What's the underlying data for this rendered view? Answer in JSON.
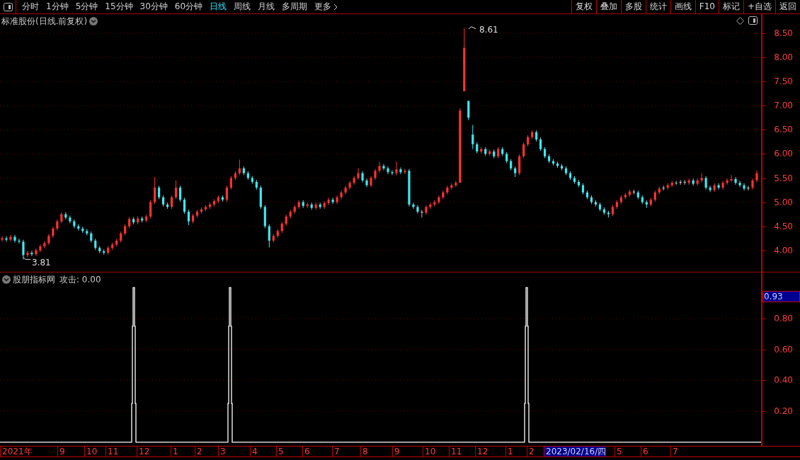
{
  "toolbar": {
    "periods": [
      {
        "label": "分时",
        "selected": false
      },
      {
        "label": "1分钟",
        "selected": false
      },
      {
        "label": "5分钟",
        "selected": false
      },
      {
        "label": "15分钟",
        "selected": false
      },
      {
        "label": "30分钟",
        "selected": false
      },
      {
        "label": "60分钟",
        "selected": false
      },
      {
        "label": "日线",
        "selected": true
      },
      {
        "label": "周线",
        "selected": false
      },
      {
        "label": "月线",
        "selected": false
      },
      {
        "label": "多周期",
        "selected": false
      }
    ],
    "more": "更多",
    "tools": [
      "复权",
      "叠加",
      "多股",
      "统计",
      "画线",
      "F10",
      "标记",
      "+自选",
      "返回"
    ]
  },
  "price_chart": {
    "title": "标准股份(日线.前复权)",
    "high_label": "8.61",
    "low_label": "3.81",
    "chart_data": {
      "type": "candlestick",
      "ohlc": [
        [
          4.22,
          4.29,
          4.18,
          4.25
        ],
        [
          4.25,
          4.29,
          4.18,
          4.22
        ],
        [
          4.22,
          4.32,
          4.18,
          4.28
        ],
        [
          4.28,
          4.32,
          4.16,
          4.2
        ],
        [
          4.2,
          4.24,
          4.14,
          4.18
        ],
        [
          4.18,
          4.22,
          3.81,
          3.9
        ],
        [
          3.9,
          3.99,
          3.86,
          3.95
        ],
        [
          3.95,
          3.99,
          3.88,
          3.92
        ],
        [
          3.92,
          4.04,
          3.88,
          4.0
        ],
        [
          4.0,
          4.12,
          3.96,
          4.08
        ],
        [
          4.08,
          4.19,
          4.04,
          4.15
        ],
        [
          4.15,
          4.34,
          4.11,
          4.3
        ],
        [
          4.3,
          4.49,
          4.26,
          4.45
        ],
        [
          4.45,
          4.64,
          4.41,
          4.6
        ],
        [
          4.6,
          4.79,
          4.56,
          4.75
        ],
        [
          4.75,
          4.79,
          4.64,
          4.68
        ],
        [
          4.68,
          4.72,
          4.56,
          4.6
        ],
        [
          4.6,
          4.64,
          4.46,
          4.5
        ],
        [
          4.5,
          4.54,
          4.41,
          4.45
        ],
        [
          4.45,
          4.49,
          4.36,
          4.4
        ],
        [
          4.4,
          4.44,
          4.31,
          4.35
        ],
        [
          4.35,
          4.39,
          4.16,
          4.2
        ],
        [
          4.2,
          4.24,
          4.01,
          4.05
        ],
        [
          4.05,
          4.09,
          3.94,
          3.98
        ],
        [
          3.98,
          4.02,
          3.91,
          3.95
        ],
        [
          3.95,
          4.09,
          3.91,
          4.05
        ],
        [
          4.05,
          4.16,
          4.01,
          4.12
        ],
        [
          4.12,
          4.24,
          4.08,
          4.2
        ],
        [
          4.2,
          4.39,
          4.16,
          4.35
        ],
        [
          4.35,
          4.54,
          4.31,
          4.5
        ],
        [
          4.5,
          4.69,
          4.46,
          4.65
        ],
        [
          4.65,
          4.69,
          4.54,
          4.58
        ],
        [
          4.58,
          4.7,
          4.54,
          4.66
        ],
        [
          4.66,
          4.7,
          4.58,
          4.62
        ],
        [
          4.62,
          4.74,
          4.58,
          4.7
        ],
        [
          4.7,
          5.04,
          4.66,
          5.0
        ],
        [
          5.0,
          5.52,
          4.96,
          5.3
        ],
        [
          5.3,
          5.34,
          5.06,
          5.1
        ],
        [
          5.1,
          5.14,
          4.91,
          4.95
        ],
        [
          4.95,
          4.99,
          4.86,
          4.9
        ],
        [
          4.9,
          5.14,
          4.86,
          5.1
        ],
        [
          5.1,
          5.45,
          5.06,
          5.3
        ],
        [
          5.3,
          5.34,
          5.01,
          5.05
        ],
        [
          5.05,
          5.09,
          4.76,
          4.8
        ],
        [
          4.8,
          4.84,
          4.52,
          4.6
        ],
        [
          4.6,
          4.76,
          4.56,
          4.72
        ],
        [
          4.72,
          4.84,
          4.68,
          4.8
        ],
        [
          4.8,
          4.89,
          4.76,
          4.85
        ],
        [
          4.85,
          4.94,
          4.81,
          4.9
        ],
        [
          4.9,
          4.99,
          4.86,
          4.95
        ],
        [
          4.95,
          5.06,
          4.91,
          5.02
        ],
        [
          5.02,
          5.14,
          4.98,
          5.1
        ],
        [
          5.1,
          5.14,
          5.01,
          5.05
        ],
        [
          5.05,
          5.34,
          5.01,
          5.3
        ],
        [
          5.3,
          5.54,
          5.26,
          5.5
        ],
        [
          5.5,
          5.64,
          5.46,
          5.6
        ],
        [
          5.6,
          5.88,
          5.56,
          5.7
        ],
        [
          5.7,
          5.74,
          5.56,
          5.6
        ],
        [
          5.6,
          5.64,
          5.46,
          5.5
        ],
        [
          5.5,
          5.54,
          5.38,
          5.42
        ],
        [
          5.42,
          5.46,
          5.26,
          5.3
        ],
        [
          5.3,
          5.34,
          4.86,
          4.9
        ],
        [
          4.9,
          4.94,
          4.46,
          4.5
        ],
        [
          4.5,
          4.54,
          4.06,
          4.2
        ],
        [
          4.2,
          4.34,
          4.16,
          4.3
        ],
        [
          4.3,
          4.44,
          4.26,
          4.4
        ],
        [
          4.4,
          4.59,
          4.36,
          4.55
        ],
        [
          4.55,
          4.74,
          4.51,
          4.7
        ],
        [
          4.7,
          4.84,
          4.66,
          4.8
        ],
        [
          4.8,
          4.94,
          4.76,
          4.9
        ],
        [
          4.9,
          5.04,
          4.86,
          5.0
        ],
        [
          5.0,
          5.04,
          4.88,
          4.92
        ],
        [
          4.92,
          4.99,
          4.88,
          4.95
        ],
        [
          4.95,
          4.99,
          4.84,
          4.88
        ],
        [
          4.88,
          4.99,
          4.84,
          4.95
        ],
        [
          4.95,
          4.99,
          4.86,
          4.9
        ],
        [
          4.9,
          5.02,
          4.86,
          4.98
        ],
        [
          4.98,
          5.09,
          4.94,
          5.05
        ],
        [
          5.05,
          5.09,
          4.96,
          5.0
        ],
        [
          5.0,
          5.14,
          4.96,
          5.1
        ],
        [
          5.1,
          5.24,
          5.06,
          5.2
        ],
        [
          5.2,
          5.34,
          5.16,
          5.3
        ],
        [
          5.3,
          5.44,
          5.26,
          5.4
        ],
        [
          5.4,
          5.54,
          5.36,
          5.5
        ],
        [
          5.5,
          5.7,
          5.46,
          5.6
        ],
        [
          5.6,
          5.64,
          5.41,
          5.45
        ],
        [
          5.45,
          5.49,
          5.31,
          5.35
        ],
        [
          5.35,
          5.54,
          5.31,
          5.5
        ],
        [
          5.5,
          5.69,
          5.46,
          5.65
        ],
        [
          5.65,
          5.84,
          5.61,
          5.75
        ],
        [
          5.75,
          5.79,
          5.66,
          5.7
        ],
        [
          5.7,
          5.74,
          5.58,
          5.62
        ],
        [
          5.62,
          5.66,
          5.56,
          5.6
        ],
        [
          5.6,
          5.84,
          5.56,
          5.68
        ],
        [
          5.68,
          5.72,
          5.58,
          5.62
        ],
        [
          5.62,
          5.69,
          5.58,
          5.65
        ],
        [
          5.65,
          5.69,
          4.91,
          4.95
        ],
        [
          4.95,
          4.99,
          4.86,
          4.9
        ],
        [
          4.9,
          4.94,
          4.76,
          4.8
        ],
        [
          4.8,
          4.84,
          4.68,
          4.78
        ],
        [
          4.78,
          4.94,
          4.74,
          4.9
        ],
        [
          4.9,
          4.99,
          4.86,
          4.95
        ],
        [
          4.95,
          5.04,
          4.91,
          5.0
        ],
        [
          5.0,
          5.14,
          4.96,
          5.1
        ],
        [
          5.1,
          5.24,
          5.06,
          5.2
        ],
        [
          5.2,
          5.34,
          5.16,
          5.3
        ],
        [
          5.3,
          5.39,
          5.26,
          5.35
        ],
        [
          5.35,
          5.44,
          5.31,
          5.4
        ],
        [
          5.4,
          6.95,
          5.4,
          6.9
        ],
        [
          7.3,
          8.61,
          7.3,
          8.2
        ],
        [
          7.1,
          7.1,
          6.7,
          6.75
        ],
        [
          6.4,
          6.6,
          6.1,
          6.2
        ],
        [
          6.2,
          6.24,
          6.01,
          6.05
        ],
        [
          6.05,
          6.14,
          6.01,
          6.1
        ],
        [
          6.1,
          6.14,
          5.96,
          6.0
        ],
        [
          6.0,
          6.09,
          5.96,
          6.05
        ],
        [
          6.05,
          6.09,
          5.91,
          5.95
        ],
        [
          5.95,
          6.14,
          5.91,
          6.1
        ],
        [
          6.1,
          6.14,
          5.96,
          6.0
        ],
        [
          6.0,
          6.04,
          5.81,
          5.85
        ],
        [
          5.85,
          5.89,
          5.66,
          5.7
        ],
        [
          5.7,
          5.74,
          5.52,
          5.6
        ],
        [
          5.6,
          5.99,
          5.56,
          5.95
        ],
        [
          5.95,
          6.24,
          5.91,
          6.2
        ],
        [
          6.2,
          6.39,
          6.16,
          6.35
        ],
        [
          6.35,
          6.49,
          6.31,
          6.45
        ],
        [
          6.45,
          6.49,
          6.26,
          6.3
        ],
        [
          6.3,
          6.34,
          6.06,
          6.1
        ],
        [
          6.1,
          6.14,
          5.91,
          5.95
        ],
        [
          5.95,
          5.99,
          5.81,
          5.85
        ],
        [
          5.85,
          5.89,
          5.76,
          5.8
        ],
        [
          5.8,
          5.84,
          5.71,
          5.75
        ],
        [
          5.75,
          5.79,
          5.66,
          5.7
        ],
        [
          5.7,
          5.74,
          5.56,
          5.6
        ],
        [
          5.6,
          5.64,
          5.46,
          5.5
        ],
        [
          5.5,
          5.54,
          5.38,
          5.42
        ],
        [
          5.42,
          5.46,
          5.31,
          5.35
        ],
        [
          5.35,
          5.39,
          5.16,
          5.2
        ],
        [
          5.2,
          5.24,
          5.06,
          5.1
        ],
        [
          5.1,
          5.14,
          4.96,
          5.0
        ],
        [
          5.0,
          5.04,
          4.91,
          4.95
        ],
        [
          4.95,
          4.99,
          4.81,
          4.85
        ],
        [
          4.85,
          4.89,
          4.74,
          4.78
        ],
        [
          4.78,
          4.82,
          4.68,
          4.75
        ],
        [
          4.75,
          4.94,
          4.71,
          4.9
        ],
        [
          4.9,
          5.04,
          4.86,
          5.0
        ],
        [
          5.0,
          5.14,
          4.96,
          5.1
        ],
        [
          5.1,
          5.19,
          5.06,
          5.15
        ],
        [
          5.15,
          5.26,
          5.11,
          5.22
        ],
        [
          5.22,
          5.26,
          5.16,
          5.2
        ],
        [
          5.2,
          5.24,
          5.06,
          5.1
        ],
        [
          5.1,
          5.14,
          4.96,
          5.0
        ],
        [
          5.0,
          5.04,
          4.88,
          4.95
        ],
        [
          4.95,
          5.09,
          4.91,
          5.05
        ],
        [
          5.05,
          5.24,
          5.01,
          5.2
        ],
        [
          5.2,
          5.32,
          5.16,
          5.28
        ],
        [
          5.28,
          5.34,
          5.24,
          5.3
        ],
        [
          5.3,
          5.39,
          5.26,
          5.35
        ],
        [
          5.35,
          5.44,
          5.31,
          5.4
        ],
        [
          5.4,
          5.44,
          5.36,
          5.4
        ],
        [
          5.4,
          5.46,
          5.36,
          5.42
        ],
        [
          5.42,
          5.46,
          5.36,
          5.4
        ],
        [
          5.4,
          5.49,
          5.36,
          5.45
        ],
        [
          5.45,
          5.49,
          5.34,
          5.38
        ],
        [
          5.38,
          5.49,
          5.34,
          5.45
        ],
        [
          5.45,
          5.6,
          5.41,
          5.5
        ],
        [
          5.5,
          5.54,
          5.26,
          5.3
        ],
        [
          5.3,
          5.34,
          5.21,
          5.25
        ],
        [
          5.25,
          5.39,
          5.21,
          5.35
        ],
        [
          5.35,
          5.39,
          5.26,
          5.3
        ],
        [
          5.3,
          5.44,
          5.26,
          5.4
        ],
        [
          5.4,
          5.49,
          5.36,
          5.45
        ],
        [
          5.45,
          5.56,
          5.41,
          5.48
        ],
        [
          5.48,
          5.52,
          5.36,
          5.4
        ],
        [
          5.4,
          5.44,
          5.31,
          5.35
        ],
        [
          5.35,
          5.39,
          5.24,
          5.28
        ],
        [
          5.28,
          5.34,
          5.24,
          5.3
        ],
        [
          5.3,
          5.49,
          5.26,
          5.45
        ],
        [
          5.45,
          5.66,
          5.41,
          5.6
        ]
      ],
      "ylim": [
        3.54,
        8.9
      ],
      "grid": true,
      "yticks": [
        {
          "value": 8.5,
          "label": "8.50"
        },
        {
          "value": 8.0,
          "label": "8.00"
        },
        {
          "value": 7.5,
          "label": "7.50"
        },
        {
          "value": 7.0,
          "label": "7.00"
        },
        {
          "value": 6.5,
          "label": "6.50"
        },
        {
          "value": 6.0,
          "label": "6.00"
        },
        {
          "value": 5.5,
          "label": "5.50"
        },
        {
          "value": 5.0,
          "label": "5.00"
        },
        {
          "value": 4.5,
          "label": "4.50"
        },
        {
          "value": 4.0,
          "label": "4.00"
        }
      ]
    }
  },
  "indicator": {
    "name": "股朋指标网",
    "reading": "攻击: 0.00",
    "cursor_value": "0.93",
    "axis_labels": [
      "0.80",
      "0.60",
      "0.40",
      "0.20"
    ]
  },
  "date_axis": {
    "labels": [
      {
        "text": "2021年",
        "selected": false
      },
      {
        "text": "9",
        "selected": false
      },
      {
        "text": "10",
        "selected": false
      },
      {
        "text": "11",
        "selected": false
      },
      {
        "text": "12",
        "selected": false
      },
      {
        "text": "1",
        "selected": false
      },
      {
        "text": "2",
        "selected": false
      },
      {
        "text": "3",
        "selected": false
      },
      {
        "text": "4",
        "selected": false
      },
      {
        "text": "5",
        "selected": false
      },
      {
        "text": "6",
        "selected": false
      },
      {
        "text": "7",
        "selected": false
      },
      {
        "text": "8",
        "selected": false
      },
      {
        "text": "9",
        "selected": false
      },
      {
        "text": "10",
        "selected": false
      },
      {
        "text": "11",
        "selected": false
      },
      {
        "text": "12",
        "selected": false
      },
      {
        "text": "1",
        "selected": false
      },
      {
        "text": "2",
        "selected": false
      },
      {
        "text": "2023/02/16/四",
        "selected": true
      },
      {
        "text": "5",
        "selected": false
      },
      {
        "text": "6",
        "selected": false
      },
      {
        "text": "7",
        "selected": false
      }
    ]
  }
}
